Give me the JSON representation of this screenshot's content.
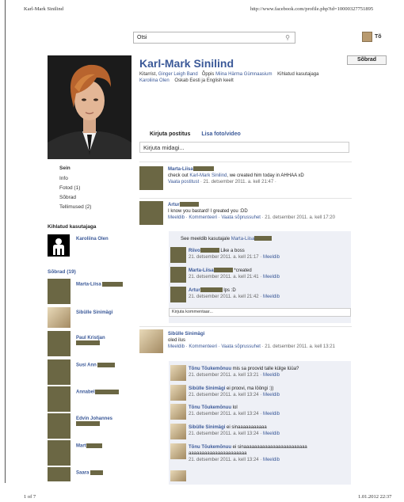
{
  "print_header": {
    "left": "Karl-Mark Sinilind",
    "url": "http://www.facebook.com/profile.php?id=10000327751895"
  },
  "search": {
    "value": "Otsi"
  },
  "topbar": {
    "user_short": "Tõ"
  },
  "profile": {
    "name": "Karl-Mark Sinilind",
    "friends_button": "Sõbrad",
    "info_line1_a": "Kitarrist,",
    "info_line1_link": "Ginger Leigh Band",
    "info_line1_b": "Õppis",
    "info_line1_link2": "Miina Härma Gümnaasium",
    "info_line1_c": "Kihlatud kasutajaga",
    "info_line2_link": "Karoliina Olen",
    "info_line2_b": "Oskab Eesti ja English keelt"
  },
  "sidebar": {
    "nav": [
      "Sein",
      "Info",
      "Fotod (1)",
      "Sõbrad",
      "Tellimused (2)"
    ],
    "engaged_title": "Kihlatud kasutajaga",
    "engaged_name": "Karoliina Olen",
    "friends_title": "Sõbrad (19)",
    "friends": [
      "Marta-Liisa",
      "Sibülle Sinimägi",
      "Paul Kristjan",
      "Susi Ann",
      "Annabel",
      "Edvin Johannes",
      "Mart",
      "Saara"
    ]
  },
  "composer": {
    "tab_post": "Kirjuta postitus",
    "tab_photo": "Lisa foto/video",
    "placeholder": "Kirjuta midagi..."
  },
  "posts": [
    {
      "author": "Marta-Liisa",
      "text_a": "check out",
      "text_link": "Karl-Mark Sinilind",
      "text_b": ", we created him today in AHHAA xD",
      "meta_link": "Vaata postitust",
      "meta_time": "· 21. detsember 2011. a. kell 21:47 ·"
    },
    {
      "author": "Artur",
      "text": "I know you bastard! I greated you :DD",
      "meta_links": "Meeldib · Kommenteeri · Vaata sõprussuhet",
      "meta_time": "· 21. detsember 2011. a. kell 17:20",
      "likes_prefix": "See meeldib kasutajale",
      "likes_name": "Marta-Liisa",
      "comments": [
        {
          "author": "Riivo",
          "text": "Like a boss",
          "time": "21. detsember 2011. a. kell 21:17 ·",
          "like": "Meeldib"
        },
        {
          "author": "Marta-Liisa",
          "text": "*created",
          "time": "21. detsember 2011. a. kell 21:41 ·",
          "like": "Meeldib"
        },
        {
          "author": "Artur",
          "text": "lps :D",
          "time": "21. detsember 2011. a. kell 21:42 ·",
          "like": "Meeldib"
        }
      ],
      "comment_placeholder": "Kirjuta kommentaar..."
    },
    {
      "author": "Sibülle Sinimägi",
      "text": "oled ilus",
      "meta_links": "Meeldib · Kommenteeri · Vaata sõprussuhet",
      "meta_time": "· 21. detsember 2011. a. kell 13:21",
      "comments": [
        {
          "author": "Tõnu Tõukemõnuu",
          "text": "mis sa proovid talle külge lüüa?",
          "time": "21. detsember 2011. a. kell 13:21 ·",
          "like": "Meeldib"
        },
        {
          "author": "Sibülle Sinimägi",
          "text": "ei proovi, ma lööngi :))",
          "time": "21. detsember 2011. a. kell 13:24 ·",
          "like": "Meeldib"
        },
        {
          "author": "Tõnu Tõukemõnuu",
          "text": "lol",
          "time": "21. detsember 2011. a. kell 13:24 ·",
          "like": "Meeldib"
        },
        {
          "author": "Sibülle Sinimägi",
          "text": "ei sinaaaaaaaaaaa",
          "time": "21. detsember 2011. a. kell 13:24 ·",
          "like": "Meeldib"
        },
        {
          "author": "Tõnu Tõukemõnuu",
          "text": "ei sinaaaaaaaaaaaaaaaaaaaaaaaa",
          "text2": "aaaaaaaaaaaaaaaaaaaaaa",
          "time": "21. detsember 2011. a. kell 13:24 ·",
          "like": "Meeldib"
        }
      ]
    }
  ],
  "print_footer": {
    "left": "1 of 7",
    "right": "1.01.2012 22:37"
  }
}
